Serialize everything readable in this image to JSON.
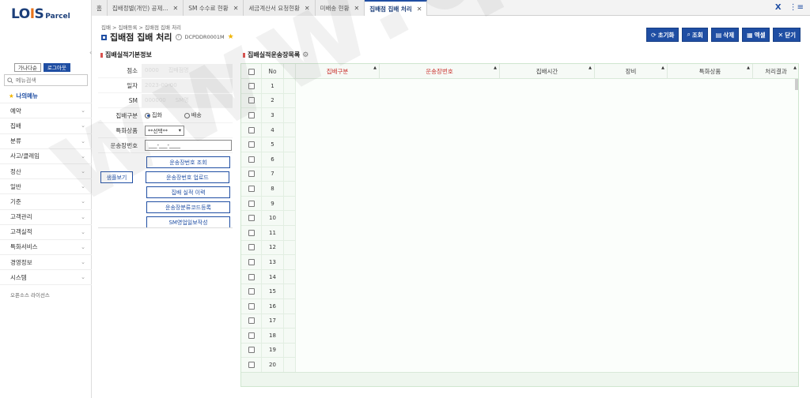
{
  "sidebar": {
    "logo_main_1": "LO",
    "logo_main_2": "I",
    "logo_main_3": "S",
    "logo_sub": "Parcel",
    "auth": {
      "join": "가나다순",
      "logout": "로그아웃"
    },
    "search_placeholder": "메뉴검색",
    "favorite": "나의메뉴",
    "items": [
      "예약",
      "집배",
      "분류",
      "사고/클레임",
      "정산",
      "일반",
      "기준",
      "고객관리",
      "고객실적",
      "특화서비스",
      "경영정보",
      "시스템"
    ],
    "open_source": "오픈소스 라이선스"
  },
  "tabs": [
    {
      "label": "홈",
      "closable": false,
      "active": false
    },
    {
      "label": "집배정별(개인) 공제...",
      "closable": true,
      "active": false
    },
    {
      "label": "SM 수수료 현황",
      "closable": true,
      "active": false
    },
    {
      "label": "세금계산서 요청현황",
      "closable": true,
      "active": false
    },
    {
      "label": "미배송 현황",
      "closable": true,
      "active": false
    },
    {
      "label": "집배점 집배 처리",
      "closable": true,
      "active": true
    }
  ],
  "tab_right": {
    "close_all": "X",
    "menu": "⋮≡"
  },
  "header": {
    "breadcrumb": "집배 > 집배등록 > 집배점 집배 처리",
    "title": "집배점 집배 처리",
    "screen_code": "DCPDDR0001M"
  },
  "toolbar": {
    "reset": "초기화",
    "search": "조회",
    "delete": "삭제",
    "excel": "엑셀",
    "close": "닫기"
  },
  "form": {
    "section_title": "집배실적기본정보",
    "labels": {
      "branch": "점소",
      "date": "일자",
      "sm": "SM",
      "type": "집배구분",
      "special": "특화상품",
      "waybill": "운송장번호"
    },
    "values": {
      "branch_code": "0000",
      "branch_name": "집배점명",
      "date": "2023-00-00",
      "sm_code": "000000",
      "sm_name": "SM명"
    },
    "type_options": {
      "pickup": "집화",
      "delivery": "배송"
    },
    "special_selected": "**선택**",
    "waybill_mask": "___-___-____",
    "buttons": {
      "waybill_search": "운송장번호 조회",
      "sample_view": "샘플보기",
      "waybill_upload": "운송장번호 업로드",
      "history": "집배 실적 이력",
      "classify_code": "운송장분류코드등록",
      "sm_daily": "SM영업일보작성"
    }
  },
  "grid": {
    "section_title": "집배실적운송장목록",
    "columns": [
      "No",
      "집배구분",
      "운송장번호",
      "집배시간",
      "장비",
      "특화상품",
      "처리결과"
    ],
    "rows": [
      "1",
      "2",
      "3",
      "4",
      "5",
      "6",
      "7",
      "8",
      "9",
      "10",
      "11",
      "12",
      "13",
      "14",
      "15",
      "16",
      "17",
      "18",
      "19",
      "20"
    ]
  },
  "watermark": "www.qee.kr",
  "colors": {
    "accent": "#1f4ea3",
    "section_marker": "#d9534f",
    "grid_tint": "#f5faf5"
  }
}
